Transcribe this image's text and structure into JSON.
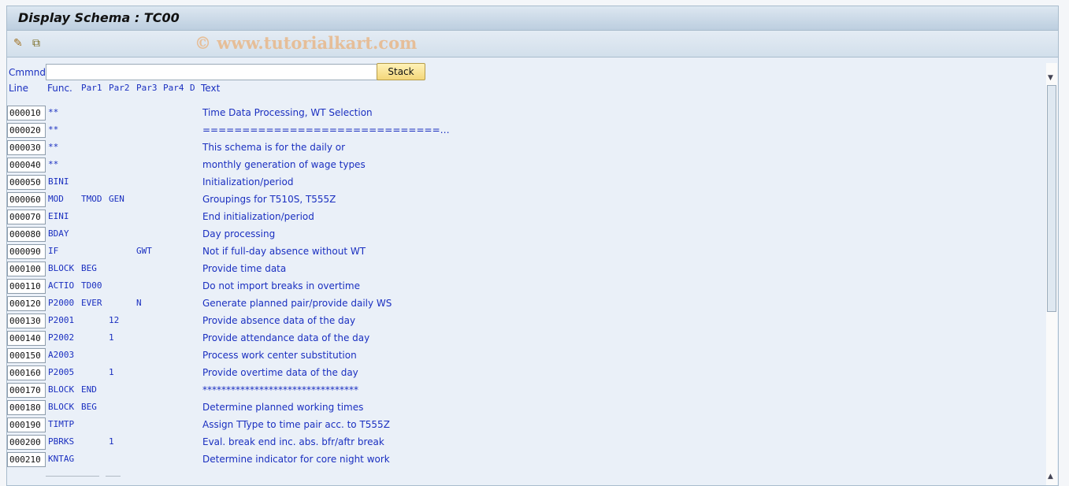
{
  "window": {
    "title": "Display Schema : TC00",
    "watermark": "© www.tutorialkart.com"
  },
  "toolbar": {
    "icons": [
      "change-pencil-icon",
      "display-change-icon"
    ]
  },
  "command": {
    "label": "Cmmnd",
    "value": "",
    "stack_label": "Stack"
  },
  "columns": {
    "line": "Line",
    "func": "Func.",
    "par1": "Par1",
    "par2": "Par2",
    "par3": "Par3",
    "par4": "Par4",
    "d": "D",
    "text": "Text"
  },
  "rows": [
    {
      "line": "000010",
      "func": "**",
      "par1": "",
      "par2": "",
      "par3": "",
      "text": "Time Data Processing, WT Selection"
    },
    {
      "line": "000020",
      "func": "**",
      "par1": "",
      "par2": "",
      "par3": "",
      "text": "==============================…"
    },
    {
      "line": "000030",
      "func": "**",
      "par1": "",
      "par2": "",
      "par3": "",
      "text": "This schema is for the daily or"
    },
    {
      "line": "000040",
      "func": "**",
      "par1": "",
      "par2": "",
      "par3": "",
      "text": "monthly generation of wage types"
    },
    {
      "line": "000050",
      "func": "BINI",
      "par1": "",
      "par2": "",
      "par3": "",
      "text": "Initialization/period"
    },
    {
      "line": "000060",
      "func": "MOD",
      "par1": "TMOD",
      "par2": "GEN",
      "par3": "",
      "text": "Groupings for T510S, T555Z"
    },
    {
      "line": "000070",
      "func": "EINI",
      "par1": "",
      "par2": "",
      "par3": "",
      "text": "End initialization/period"
    },
    {
      "line": "000080",
      "func": "BDAY",
      "par1": "",
      "par2": "",
      "par3": "",
      "text": "Day processing"
    },
    {
      "line": "000090",
      "func": "IF",
      "par1": "",
      "par2": "",
      "par3": "GWT",
      "text": "Not if full-day absence without WT"
    },
    {
      "line": "000100",
      "func": "BLOCK",
      "par1": "BEG",
      "par2": "",
      "par3": "",
      "text": "Provide time data"
    },
    {
      "line": "000110",
      "func": "ACTIO",
      "par1": "TD00",
      "par2": "",
      "par3": "",
      "text": "Do not import breaks in overtime"
    },
    {
      "line": "000120",
      "func": "P2000",
      "par1": "EVER",
      "par2": "",
      "par3": "N",
      "text": "Generate planned pair/provide daily WS"
    },
    {
      "line": "000130",
      "func": "P2001",
      "par1": "",
      "par2": "12",
      "par3": "",
      "text": "Provide absence data of the day"
    },
    {
      "line": "000140",
      "func": "P2002",
      "par1": "",
      "par2": "1",
      "par3": "",
      "text": "Provide attendance data of the day"
    },
    {
      "line": "000150",
      "func": "A2003",
      "par1": "",
      "par2": "",
      "par3": "",
      "text": "Process work center substitution"
    },
    {
      "line": "000160",
      "func": "P2005",
      "par1": "",
      "par2": "1",
      "par3": "",
      "text": "Provide overtime data of the day"
    },
    {
      "line": "000170",
      "func": "BLOCK",
      "par1": "END",
      "par2": "",
      "par3": "",
      "text": "*********************************"
    },
    {
      "line": "000180",
      "func": "BLOCK",
      "par1": "BEG",
      "par2": "",
      "par3": "",
      "text": "Determine planned working times"
    },
    {
      "line": "000190",
      "func": "TIMTP",
      "par1": "",
      "par2": "",
      "par3": "",
      "text": "Assign TType to time pair acc. to T555Z"
    },
    {
      "line": "000200",
      "func": "PBRKS",
      "par1": "",
      "par2": "1",
      "par3": "",
      "text": "Eval. break end inc. abs. bfr/aftr break"
    },
    {
      "line": "000210",
      "func": "KNTAG",
      "par1": "",
      "par2": "",
      "par3": "",
      "text": "Determine indicator for core night work"
    }
  ]
}
